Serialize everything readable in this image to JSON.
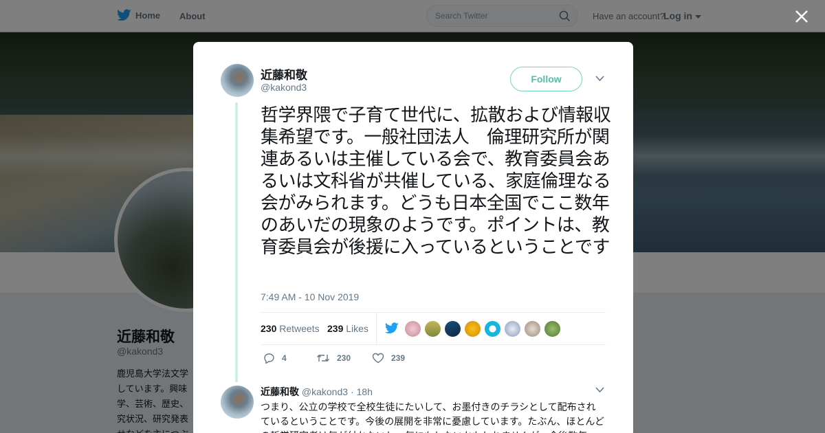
{
  "nav": {
    "home_label": "Home",
    "about_label": "About",
    "search_placeholder": "Search Twitter",
    "have_account": "Have an account?",
    "login_label": "Log in"
  },
  "profile": {
    "name": "近藤和敬",
    "handle": "@kakond3",
    "bio": "鹿児島大学法文学\nしています。興味\n学、芸術、歴史、\n究状況、研究発表\nせなどを主につぶ"
  },
  "tweet": {
    "author_name": "近藤和敬",
    "author_handle": "@kakond3",
    "follow_label": "Follow",
    "text": "哲学界隈で子育て世代に、拡散および情報収集希望です。一般社団法人　倫理研究所が関連あるいは主催している会で、教育委員会あるいは文科省が共催している、家庭倫理なる会がみられます。どうも日本全国でここ数年のあいだの現象のようです。ポイントは、教育委員会が後援に入っているということです",
    "timestamp": "7:49 AM - 10 Nov 2019",
    "retweets_count": "230",
    "retweets_label": "Retweets",
    "likes_count": "239",
    "likes_label": "Likes",
    "reply_count": "4",
    "retweet_count": "230",
    "like_count": "239"
  },
  "reply": {
    "author_name": "近藤和敬",
    "author_handle": "@kakond3",
    "separator": "·",
    "time": "18h",
    "text": "つまり、公立の学校で全校生徒にたいして、お墨付きのチラシとして配布されているということです。今後の展開を非常に憂慮しています。たぶん、ほとんどの哲学研究者は気が付かないし、気にもしないかもしれませんが、今後数年"
  },
  "colors": {
    "twitter_blue": "#1da1f2",
    "follow_accent": "#4fbfa9",
    "thread_line": "#ccf0e9",
    "muted_text": "#657786"
  }
}
